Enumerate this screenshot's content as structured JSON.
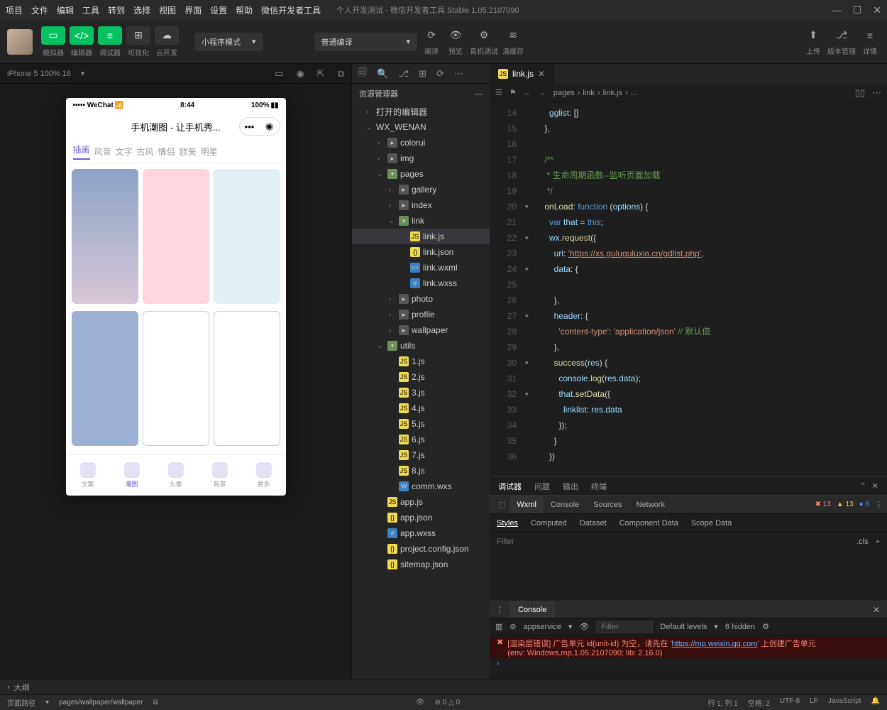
{
  "menubar": {
    "items": [
      "项目",
      "文件",
      "编辑",
      "工具",
      "转到",
      "选择",
      "视图",
      "界面",
      "设置",
      "帮助",
      "微信开发者工具"
    ],
    "title": "个人开发测试 - 微信开发者工具 Stable 1.05.2107090"
  },
  "toolbar": {
    "simulator": "模拟器",
    "editor": "编辑器",
    "debugger": "调试器",
    "visual": "可视化",
    "cloud": "云开发",
    "mode": "小程序模式",
    "compileMode": "普通编译",
    "actions": {
      "compile": "编译",
      "preview": "预览",
      "realDebug": "真机调试",
      "clearCache": "清缓存",
      "upload": "上传",
      "version": "版本管理",
      "detail": "详情"
    }
  },
  "simHeader": {
    "device": "iPhone 5 100% 16",
    "chev": "▾"
  },
  "phone": {
    "carrier": "••••• WeChat",
    "signal": "📶",
    "time": "8:44",
    "battery": "100%",
    "title": "手机潮图 - 让手机秀...",
    "tabs": [
      "插画",
      "风景",
      "文字",
      "古风",
      "情侣",
      "欧美",
      "明星"
    ],
    "tabbar": [
      "文案",
      "潮图",
      "头像",
      "背景",
      "更多"
    ]
  },
  "explorer": {
    "title": "资源管理器",
    "sections": {
      "openEditors": "打开的编辑器",
      "project": "WX_WENAN"
    },
    "tree": [
      {
        "l": 2,
        "t": "folder",
        "n": "colorui"
      },
      {
        "l": 2,
        "t": "folder",
        "n": "img"
      },
      {
        "l": 2,
        "t": "folder-open",
        "n": "pages",
        "open": true
      },
      {
        "l": 3,
        "t": "folder",
        "n": "gallery"
      },
      {
        "l": 3,
        "t": "folder",
        "n": "index"
      },
      {
        "l": 3,
        "t": "folder-open",
        "n": "link",
        "open": true
      },
      {
        "l": 4,
        "t": "js",
        "n": "link.js",
        "sel": true
      },
      {
        "l": 4,
        "t": "json",
        "n": "link.json"
      },
      {
        "l": 4,
        "t": "wxml",
        "n": "link.wxml"
      },
      {
        "l": 4,
        "t": "wxss",
        "n": "link.wxss"
      },
      {
        "l": 3,
        "t": "folder",
        "n": "photo"
      },
      {
        "l": 3,
        "t": "folder",
        "n": "profile"
      },
      {
        "l": 3,
        "t": "folder",
        "n": "wallpaper"
      },
      {
        "l": 2,
        "t": "folder-open",
        "n": "utils",
        "open": true
      },
      {
        "l": 3,
        "t": "js",
        "n": "1.js"
      },
      {
        "l": 3,
        "t": "js",
        "n": "2.js"
      },
      {
        "l": 3,
        "t": "js",
        "n": "3.js"
      },
      {
        "l": 3,
        "t": "js",
        "n": "4.js"
      },
      {
        "l": 3,
        "t": "js",
        "n": "5.js"
      },
      {
        "l": 3,
        "t": "js",
        "n": "6.js"
      },
      {
        "l": 3,
        "t": "js",
        "n": "7.js"
      },
      {
        "l": 3,
        "t": "js",
        "n": "8.js"
      },
      {
        "l": 3,
        "t": "wxs",
        "n": "comm.wxs"
      },
      {
        "l": 2,
        "t": "js",
        "n": "app.js"
      },
      {
        "l": 2,
        "t": "json",
        "n": "app.json"
      },
      {
        "l": 2,
        "t": "wxss",
        "n": "app.wxss"
      },
      {
        "l": 2,
        "t": "json",
        "n": "project.config.json"
      },
      {
        "l": 2,
        "t": "json",
        "n": "sitemap.json"
      }
    ]
  },
  "editor": {
    "tab": "link.js",
    "breadcrumb": [
      "pages",
      "link",
      "link.js",
      "..."
    ],
    "code": [
      {
        "i": 14,
        "t": "      <span class='prop'>gglist</span>: []"
      },
      {
        "i": 15,
        "t": "    },"
      },
      {
        "i": 16,
        "t": ""
      },
      {
        "i": 17,
        "t": "    <span class='cmt'>/**</span>"
      },
      {
        "i": 18,
        "t": "    <span class='cmt'> * 生命周期函数--监听页面加载</span>"
      },
      {
        "i": 19,
        "t": "    <span class='cmt'> */</span>"
      },
      {
        "i": 20,
        "t": "    <span class='fn'>onLoad</span>: <span class='kw'>function</span> (<span class='param'>options</span>) {",
        "fold": "▾"
      },
      {
        "i": 21,
        "t": "      <span class='kw'>var</span> <span class='prop'>that</span> = <span class='this'>this</span>;"
      },
      {
        "i": 22,
        "t": "      <span class='prop'>wx</span>.<span class='fn'>request</span>({",
        "fold": "▾"
      },
      {
        "i": 23,
        "t": "        <span class='prop'>url</span>: <span class='str u'>'https://xs.guluguluxia.cn/gdlist.php'</span>,"
      },
      {
        "i": 24,
        "t": "        <span class='prop'>data</span>: {",
        "fold": "▾"
      },
      {
        "i": 25,
        "t": ""
      },
      {
        "i": 26,
        "t": "        },"
      },
      {
        "i": 27,
        "t": "        <span class='prop'>header</span>: {",
        "fold": "▾"
      },
      {
        "i": 28,
        "t": "          <span class='str'>'content-type'</span>: <span class='str'>'application/json'</span> <span class='cmt'>// 默认值</span>"
      },
      {
        "i": 29,
        "t": "        },"
      },
      {
        "i": 30,
        "t": "        <span class='fn'>success</span>(<span class='param'>res</span>) {",
        "fold": "▾"
      },
      {
        "i": 31,
        "t": "          <span class='prop'>console</span>.<span class='fn'>log</span>(<span class='prop'>res</span>.<span class='prop'>data</span>);"
      },
      {
        "i": 32,
        "t": "          <span class='prop'>that</span>.<span class='fn'>setData</span>({",
        "fold": "▾"
      },
      {
        "i": 33,
        "t": "            <span class='prop'>linklist</span>: <span class='prop'>res</span>.<span class='prop'>data</span>"
      },
      {
        "i": 34,
        "t": "          });"
      },
      {
        "i": 35,
        "t": "        }"
      },
      {
        "i": 36,
        "t": "      })"
      }
    ]
  },
  "debugger": {
    "tabs": [
      "调试器",
      "问题",
      "输出",
      "终端"
    ],
    "devtools": [
      "Wxml",
      "Console",
      "Sources",
      "Network"
    ],
    "badges": {
      "err": "13",
      "warn": "13",
      "info": "6"
    },
    "stylesTabs": [
      "Styles",
      "Computed",
      "Dataset",
      "Component Data",
      "Scope Data"
    ],
    "filterPlaceholder": "Filter",
    "cls": ".cls"
  },
  "console": {
    "tab": "Console",
    "context": "appservice",
    "filterPlaceholder": "Filter",
    "levels": "Default levels",
    "hidden": "6 hidden",
    "error1": "[渲染层错误] 广告单元 id(unit-id) 为空，请先在 '",
    "errorLink": "https://mp.weixin.qq.com",
    "error1b": "' 上创建广告单元",
    "error2": "(env: Windows,mp,1.05.2107090; lib: 2.16.0)"
  },
  "outline": "大纲",
  "footer": {
    "routeLabel": "页面路径",
    "route": "pages/wallpaper/wallpaper",
    "errors": "0",
    "warnings": "0",
    "pos": "行 1, 列 1",
    "spaces": "空格: 2",
    "encoding": "UTF-8",
    "eol": "LF",
    "lang": "JavaScript"
  }
}
